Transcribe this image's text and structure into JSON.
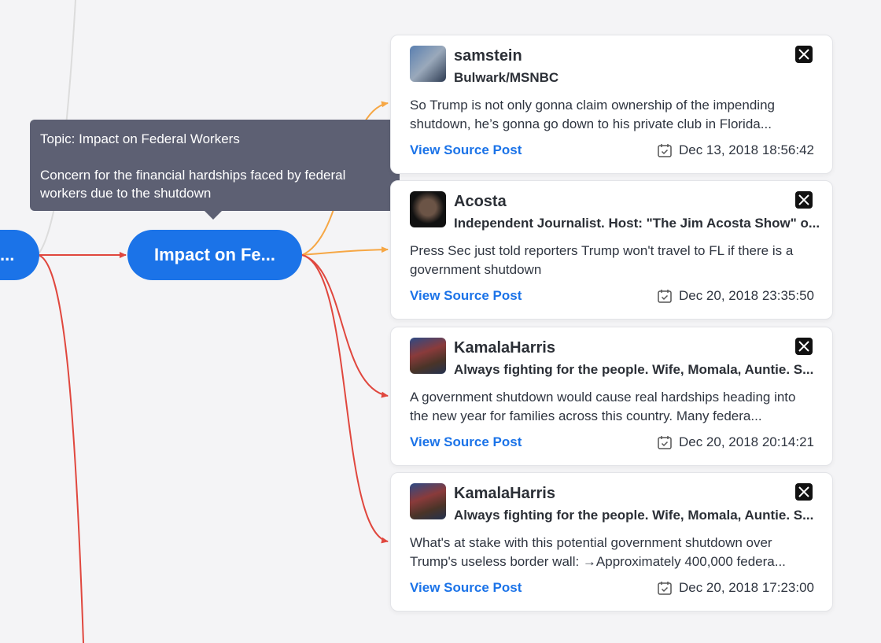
{
  "nodes": {
    "parent_label": "...",
    "topic_label": "Impact on Fe..."
  },
  "tooltip": {
    "title": "Topic: Impact on Federal Workers",
    "description": "Concern for the financial hardships faced by federal workers due to the shutdown"
  },
  "posts": [
    {
      "username": "samstein",
      "bio": "Bulwark/MSNBC",
      "text": "So Trump is not only gonna claim ownership of the impending shutdown, he’s gonna go down to his private club in Florida...",
      "link_label": "View Source Post",
      "date": "Dec 13, 2018 18:56:42",
      "platform_icon": "x-logo-icon",
      "avatar_icon": "avatar-photo-icon"
    },
    {
      "username": "Acosta",
      "bio": "Independent Journalist. Host: \"The Jim Acosta Show\" o...",
      "text": "Press Sec just told reporters Trump won't travel to FL if there is a government shutdown",
      "link_label": "View Source Post",
      "date": "Dec 20, 2018 23:35:50",
      "platform_icon": "x-logo-icon",
      "avatar_icon": "avatar-photo-icon"
    },
    {
      "username": "KamalaHarris",
      "bio": "Always fighting for the people. Wife, Momala, Auntie. S...",
      "text": "A government shutdown would cause real hardships heading into the new year for families across this country. Many federa...",
      "link_label": "View Source Post",
      "date": "Dec 20, 2018 20:14:21",
      "platform_icon": "x-logo-icon",
      "avatar_icon": "avatar-photo-icon"
    },
    {
      "username": "KamalaHarris",
      "bio": "Always fighting for the people. Wife, Momala, Auntie. S...",
      "text": "What's at stake with this potential government shutdown over Trump's useless border wall: →Approximately 400,000 federa...",
      "link_label": "View Source Post",
      "date": "Dec 20, 2018 17:23:00",
      "platform_icon": "x-logo-icon",
      "avatar_icon": "avatar-photo-icon"
    }
  ],
  "colors": {
    "node_blue": "#1b73e8",
    "link_blue": "#1b73e8",
    "edge_orange": "#f6a745",
    "edge_red": "#e0473e",
    "edge_gray": "#dcdcdc",
    "tooltip_bg": "#5d6073",
    "background": "#f4f4f6"
  }
}
